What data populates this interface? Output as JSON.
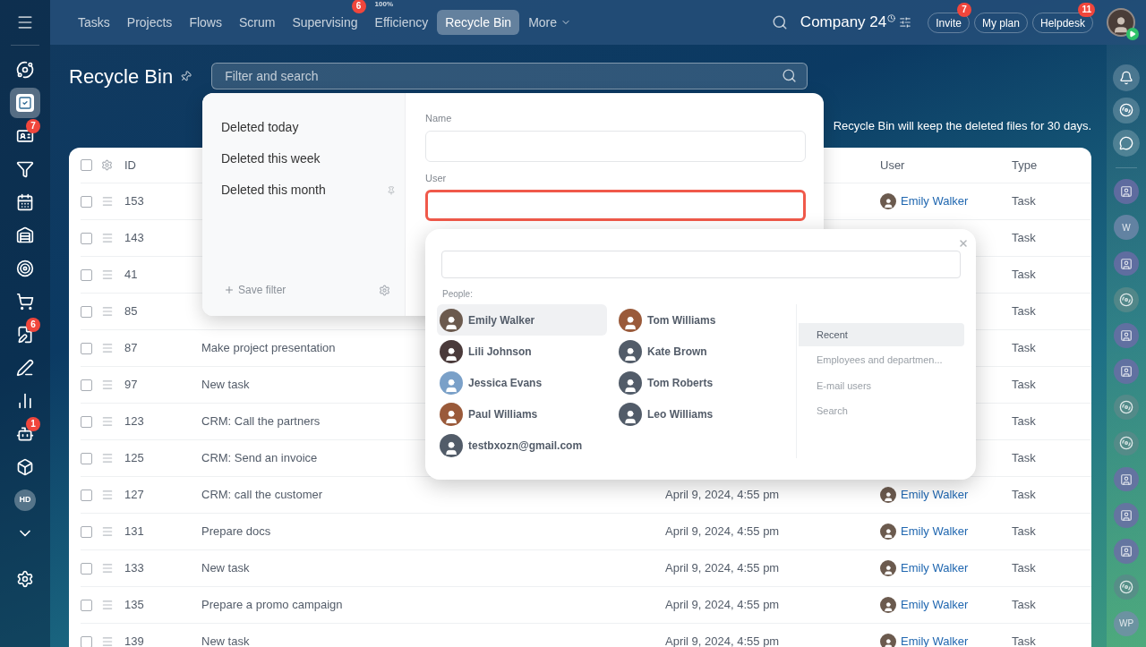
{
  "nav": {
    "items": [
      {
        "label": "Tasks",
        "selected": false
      },
      {
        "label": "Projects",
        "selected": false
      },
      {
        "label": "Flows",
        "selected": false
      },
      {
        "label": "Scrum",
        "selected": false
      },
      {
        "label": "Supervising",
        "selected": false,
        "badge": "6"
      },
      {
        "label": "Efficiency",
        "selected": false,
        "superscript": "100%"
      },
      {
        "label": "Recycle Bin",
        "selected": true
      },
      {
        "label": "More",
        "selected": false,
        "dropdown": true
      }
    ]
  },
  "header_right": {
    "company": "Company 24",
    "buttons": [
      {
        "label": "Invite",
        "badge": "7"
      },
      {
        "label": "My plan"
      },
      {
        "label": "Helpdesk",
        "badge": "11"
      }
    ]
  },
  "left_sidebar": {
    "items": [
      {
        "kind": "icon",
        "selected": false
      },
      {
        "kind": "icon",
        "selected": true
      },
      {
        "kind": "icon",
        "selected": false,
        "badge": "7"
      },
      {
        "kind": "icon",
        "selected": false
      },
      {
        "kind": "icon",
        "selected": false
      },
      {
        "kind": "icon",
        "selected": false
      },
      {
        "kind": "icon",
        "selected": false
      },
      {
        "kind": "icon",
        "selected": false
      },
      {
        "kind": "icon",
        "selected": false,
        "badge": "6"
      },
      {
        "kind": "icon",
        "selected": false
      },
      {
        "kind": "icon",
        "selected": false
      },
      {
        "kind": "icon",
        "selected": false,
        "badge": "1"
      },
      {
        "kind": "icon",
        "selected": false
      },
      {
        "kind": "avatar",
        "label": "HD",
        "selected": false
      },
      {
        "kind": "icon",
        "selected": false
      }
    ]
  },
  "right_sidebar": {
    "items": [
      {
        "kind": "contact"
      },
      {
        "kind": "letter",
        "label": "W"
      },
      {
        "kind": "contact"
      },
      {
        "kind": "spiral"
      },
      {
        "kind": "contact"
      },
      {
        "kind": "contact"
      },
      {
        "kind": "spiral"
      },
      {
        "kind": "spiral"
      },
      {
        "kind": "contact"
      },
      {
        "kind": "contact"
      },
      {
        "kind": "contact"
      },
      {
        "kind": "spiral"
      },
      {
        "kind": "letter",
        "label": "WP"
      }
    ]
  },
  "page": {
    "title": "Recycle Bin",
    "search_placeholder": "Filter and search",
    "notice": "Recycle Bin will keep the deleted files for 30 days."
  },
  "table": {
    "select_all_checked": false,
    "columns": {
      "id": "ID",
      "user": "User",
      "type": "Type"
    },
    "rows": [
      {
        "checked": false,
        "id": "153",
        "user": "Emily Walker",
        "type": "Task"
      },
      {
        "checked": false,
        "id": "143",
        "type": "Task"
      },
      {
        "checked": false,
        "id": "41",
        "type": "Task"
      },
      {
        "checked": false,
        "id": "85",
        "type": "Task"
      },
      {
        "checked": false,
        "id": "87",
        "title": "Make project presentation",
        "type": "Task"
      },
      {
        "checked": false,
        "id": "97",
        "title": "New task",
        "type": "Task"
      },
      {
        "checked": false,
        "id": "123",
        "title": "CRM: Call the partners",
        "type": "Task"
      },
      {
        "checked": false,
        "id": "125",
        "title": "CRM: Send an invoice",
        "type": "Task"
      },
      {
        "checked": false,
        "id": "127",
        "title": "CRM: call the customer",
        "date": "April 9, 2024, 4:55 pm",
        "user": "Emily Walker",
        "type": "Task"
      },
      {
        "checked": false,
        "id": "131",
        "title": "Prepare docs",
        "date": "April 9, 2024, 4:55 pm",
        "user": "Emily Walker",
        "type": "Task"
      },
      {
        "checked": false,
        "id": "133",
        "title": "New task",
        "date": "April 9, 2024, 4:55 pm",
        "user": "Emily Walker",
        "type": "Task"
      },
      {
        "checked": false,
        "id": "135",
        "title": "Prepare a promo campaign",
        "date": "April 9, 2024, 4:55 pm",
        "user": "Emily Walker",
        "type": "Task"
      },
      {
        "checked": false,
        "id": "139",
        "title": "New task",
        "date": "April 9, 2024, 4:55 pm",
        "user": "Emily Walker",
        "type": "Task"
      }
    ]
  },
  "filter_popup": {
    "presets": [
      {
        "label": "Deleted today",
        "pinned": false
      },
      {
        "label": "Deleted this week",
        "pinned": false
      },
      {
        "label": "Deleted this month",
        "pinned": true
      }
    ],
    "save_filter": "Save filter",
    "fields": [
      {
        "label": "Name",
        "focused": false
      },
      {
        "label": "User",
        "focused": true
      }
    ]
  },
  "user_popup": {
    "people_label": "People:",
    "people": [
      {
        "name": "Emily Walker",
        "kind": "photo",
        "selected": true
      },
      {
        "name": "Tom Williams",
        "kind": "photo",
        "selected": false
      },
      {
        "name": "Lili Johnson",
        "kind": "photo",
        "selected": false
      },
      {
        "name": "Kate Brown",
        "kind": "default",
        "selected": false
      },
      {
        "name": "Jessica Evans",
        "kind": "photo",
        "selected": false
      },
      {
        "name": "Tom Roberts",
        "kind": "default",
        "selected": false
      },
      {
        "name": "Paul Williams",
        "kind": "photo",
        "selected": false
      },
      {
        "name": "Leo Williams",
        "kind": "default",
        "selected": false
      },
      {
        "name": "testbxozn@gmail.com",
        "kind": "default",
        "selected": false
      }
    ],
    "tabs": [
      {
        "label": "Recent",
        "selected": true
      },
      {
        "label": "Employees and departmen...",
        "selected": false
      },
      {
        "label": "E-mail users",
        "selected": false
      },
      {
        "label": "Search",
        "selected": false
      }
    ]
  }
}
